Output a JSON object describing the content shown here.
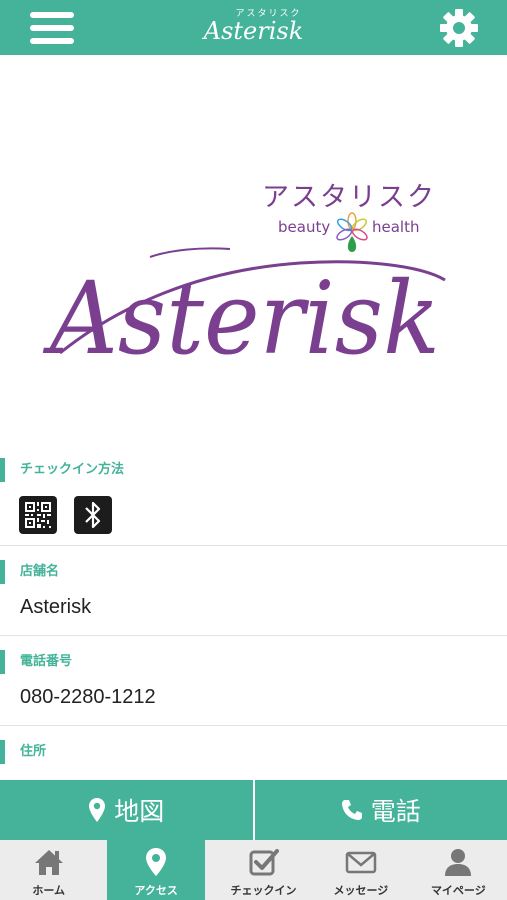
{
  "header": {
    "logo_kana": "アスタリスク",
    "logo_script": "Asterisk",
    "menu_icon": "hamburger-menu-icon",
    "settings_icon": "gear-icon"
  },
  "brand_logo": {
    "kana": "アスタリスク",
    "tagline_left": "beauty",
    "tagline_right": "health",
    "script": "Asterisk",
    "color": "#7b3f8f"
  },
  "checkin": {
    "label": "チェックイン方法",
    "icons": [
      "qr-code-icon",
      "bluetooth-icon"
    ]
  },
  "store": {
    "label": "店舗名",
    "value": "Asterisk"
  },
  "phone": {
    "label": "電話番号",
    "value": "080-2280-1212"
  },
  "address": {
    "label": "住所"
  },
  "actions": {
    "map_label": "地図",
    "call_label": "電話"
  },
  "tabs": [
    {
      "label": "ホーム",
      "icon": "home-icon",
      "active": false
    },
    {
      "label": "アクセス",
      "icon": "map-pin-icon",
      "active": true
    },
    {
      "label": "チェックイン",
      "icon": "checkbox-icon",
      "active": false
    },
    {
      "label": "メッセージ",
      "icon": "envelope-icon",
      "active": false
    },
    {
      "label": "マイページ",
      "icon": "user-icon",
      "active": false
    }
  ],
  "colors": {
    "accent": "#44b39a",
    "logo_purple": "#7b3f8f"
  }
}
